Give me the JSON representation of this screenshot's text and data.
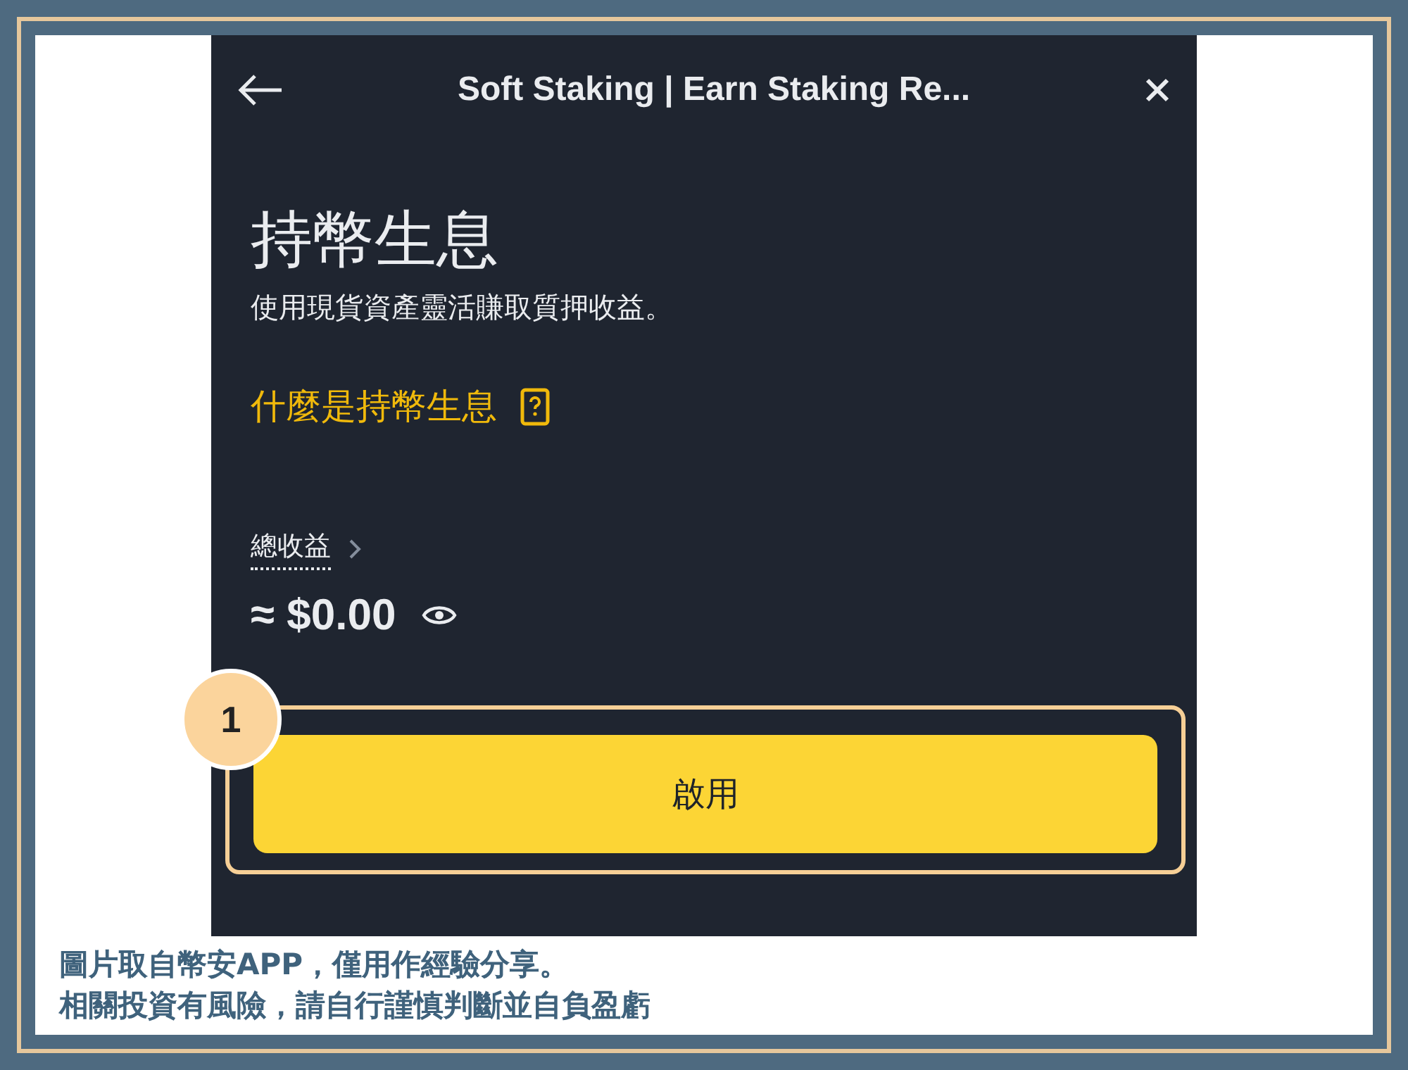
{
  "header": {
    "title": "Soft Staking | Earn Staking Re..."
  },
  "page": {
    "title": "持幣生息",
    "subtitle": "使用現貨資產靈活賺取質押收益。",
    "help_link": "什麼是持幣生息"
  },
  "earnings": {
    "label": "總收益",
    "amount": "≈ $0.00"
  },
  "enable_button": {
    "label": "啟用",
    "highlighted": true
  },
  "callout": {
    "number": "1"
  },
  "caption": [
    "圖片取自幣安APP，僅用作經驗分享。",
    "相關投資有風險，請自行謹慎判斷並自負盈虧"
  ]
}
